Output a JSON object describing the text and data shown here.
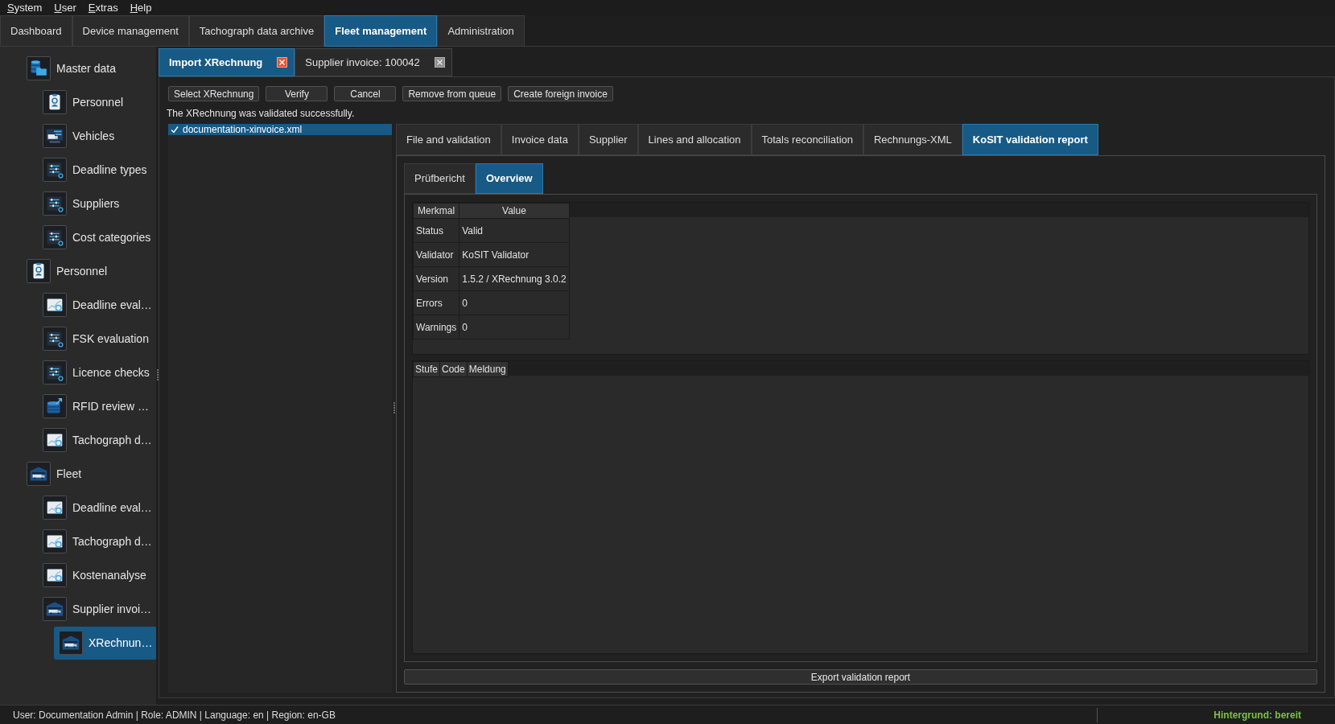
{
  "menu": [
    "System",
    "User",
    "Extras",
    "Help"
  ],
  "main_tabs": [
    {
      "label": "Dashboard",
      "selected": false
    },
    {
      "label": "Device management",
      "selected": false
    },
    {
      "label": "Tachograph data archive",
      "selected": false
    },
    {
      "label": "Fleet management",
      "selected": true
    },
    {
      "label": "Administration",
      "selected": false
    }
  ],
  "sidebar": {
    "items": [
      {
        "label": "Master data",
        "kind": "database",
        "selected": false,
        "children": [
          {
            "label": "Personnel",
            "kind": "badge",
            "selected": false
          },
          {
            "label": "Vehicles",
            "kind": "monitor",
            "selected": false
          },
          {
            "label": "Deadline types",
            "kind": "sliders",
            "selected": false
          },
          {
            "label": "Suppliers",
            "kind": "sliders",
            "selected": false
          },
          {
            "label": "Cost categories",
            "kind": "sliders",
            "selected": false
          }
        ]
      },
      {
        "label": "Personnel",
        "kind": "badge",
        "selected": false,
        "children": [
          {
            "label": "Deadline eval…",
            "kind": "chart",
            "selected": false
          },
          {
            "label": "FSK evaluation",
            "kind": "sliders",
            "selected": false
          },
          {
            "label": "Licence checks",
            "kind": "sliders",
            "selected": false
          },
          {
            "label": "RFID review …",
            "kind": "export",
            "selected": false
          },
          {
            "label": "Tachograph d…",
            "kind": "chart",
            "selected": false
          }
        ]
      },
      {
        "label": "Fleet",
        "kind": "garage",
        "selected": false,
        "children": [
          {
            "label": "Deadline eval…",
            "kind": "chart",
            "selected": false
          },
          {
            "label": "Tachograph d…",
            "kind": "chart",
            "selected": false
          },
          {
            "label": "Kostenanalyse",
            "kind": "chart",
            "selected": false
          },
          {
            "label": "Supplier invoi…",
            "kind": "garage",
            "selected": false,
            "children": [
              {
                "label": "XRechnun…",
                "kind": "garage",
                "selected": true
              }
            ]
          }
        ]
      }
    ]
  },
  "document_tabs": [
    {
      "label": "Import XRechnung",
      "selected": true
    },
    {
      "label": "Supplier invoice: 100042",
      "selected": false
    }
  ],
  "toolbar": [
    "Select XRechnung",
    "Verify",
    "Cancel",
    "Remove from queue",
    "Create foreign invoice"
  ],
  "message": "The XRechnung was validated successfully.",
  "files": [
    {
      "name": "documentation-xinvoice.xml",
      "selected": true,
      "valid": true
    }
  ],
  "detail_tabs": [
    {
      "label": "File and validation",
      "selected": false
    },
    {
      "label": "Invoice data",
      "selected": false
    },
    {
      "label": "Supplier",
      "selected": false
    },
    {
      "label": "Lines and allocation",
      "selected": false
    },
    {
      "label": "Totals reconciliation",
      "selected": false
    },
    {
      "label": "Rechnungs-XML",
      "selected": false
    },
    {
      "label": "KoSIT validation report",
      "selected": true
    }
  ],
  "report_tabs": [
    {
      "label": "Prüfbericht",
      "selected": false
    },
    {
      "label": "Overview",
      "selected": true
    }
  ],
  "summary_table": {
    "columns": [
      "Merkmal",
      "Value"
    ],
    "rows": [
      [
        "Status",
        "Valid"
      ],
      [
        "Validator",
        "KoSIT Validator"
      ],
      [
        "Version",
        "1.5.2 / XRechnung 3.0.2"
      ],
      [
        "Errors",
        "0"
      ],
      [
        "Warnings",
        "0"
      ]
    ]
  },
  "findings_table": {
    "columns": [
      "Stufe",
      "Code",
      "Meldung"
    ]
  },
  "export_button": "Export validation report",
  "status_bar": {
    "session": "User: Documentation Admin | Role: ADMIN | Language: en | Region: en-GB",
    "background_status": "Hintergrund: bereit"
  }
}
